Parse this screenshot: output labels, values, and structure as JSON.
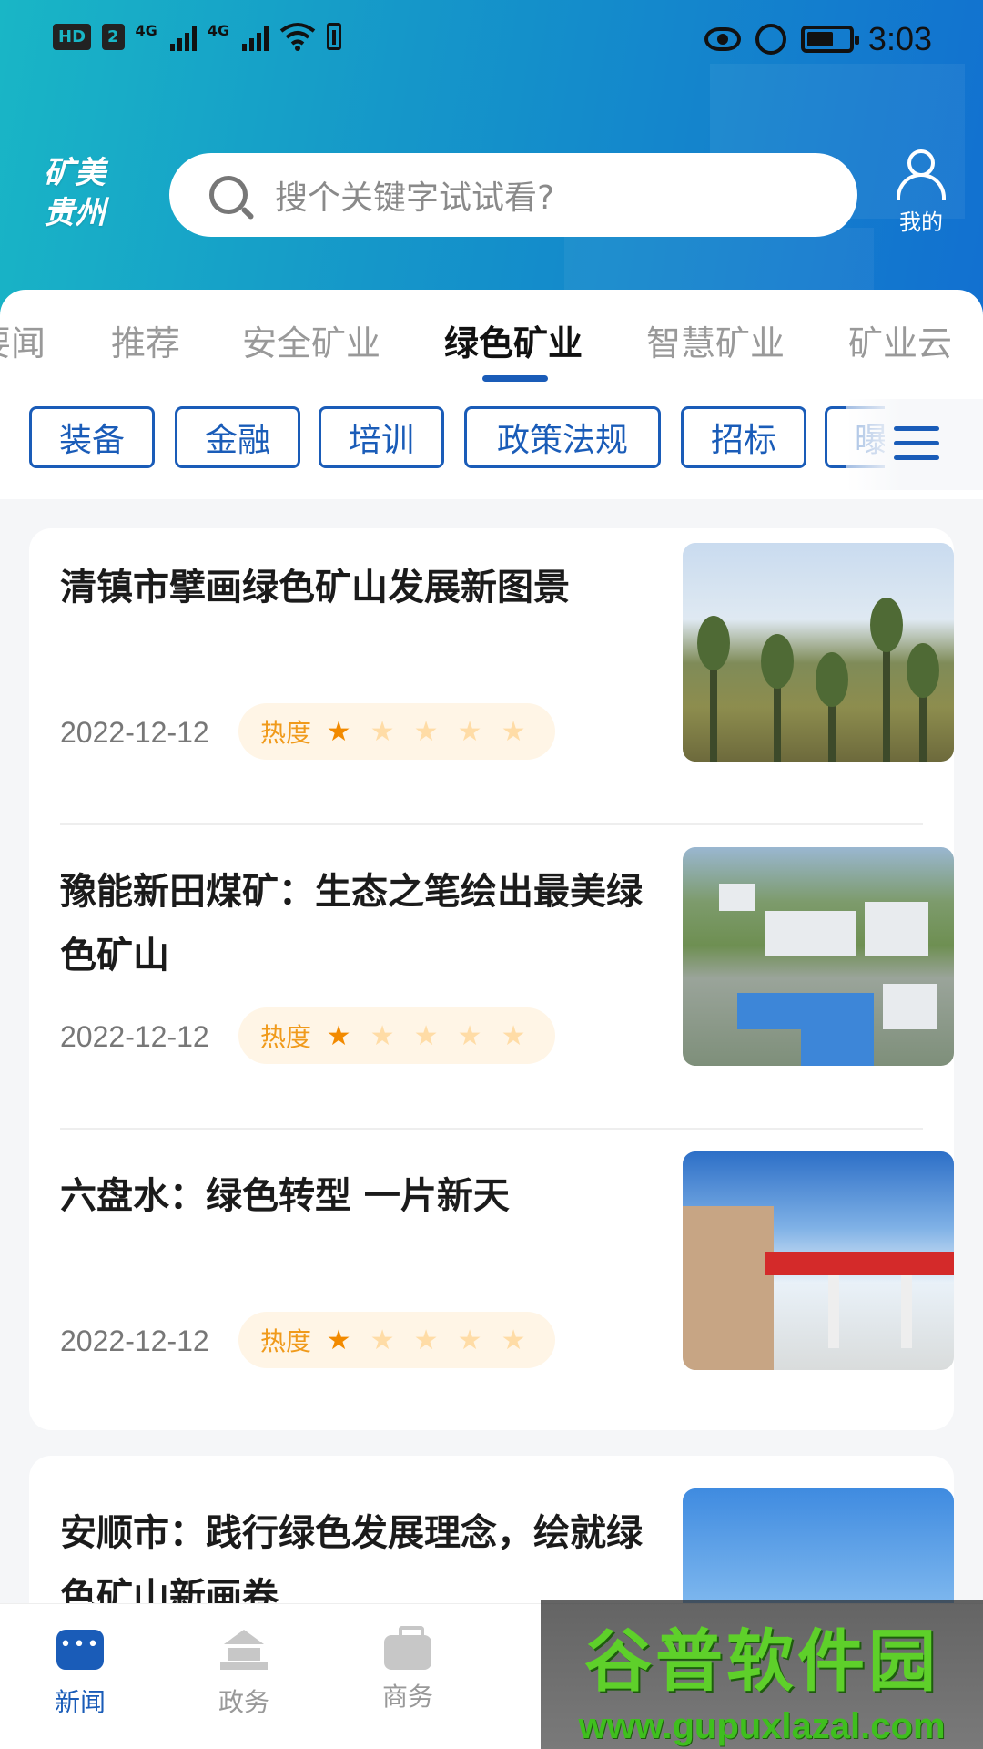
{
  "status_bar": {
    "left_badges": [
      "HD",
      "2"
    ],
    "signal_labels": [
      "4G",
      "4G"
    ],
    "time": "3:03"
  },
  "header": {
    "logo_line1": "矿美",
    "logo_line2": "贵州",
    "search_placeholder": "搜个关键字试试看?",
    "profile_label": "我的"
  },
  "tabs": [
    {
      "label": "要闻",
      "active": false
    },
    {
      "label": "推荐",
      "active": false
    },
    {
      "label": "安全矿业",
      "active": false
    },
    {
      "label": "绿色矿业",
      "active": true
    },
    {
      "label": "智慧矿业",
      "active": false
    },
    {
      "label": "矿业云",
      "active": false
    }
  ],
  "chips": [
    "装备",
    "金融",
    "培训",
    "政策法规",
    "招标",
    "曝"
  ],
  "articles": [
    {
      "title": "清镇市擘画绿色矿山发展新图景",
      "date": "2022-12-12",
      "heat_label": "热度",
      "heat_stars": 1,
      "max_stars": 5,
      "thumb": "pine-trees"
    },
    {
      "title": "豫能新田煤矿：生态之笔绘出最美绿色矿山",
      "date": "2022-12-12",
      "heat_label": "热度",
      "heat_stars": 1,
      "max_stars": 5,
      "thumb": "mine-facility"
    },
    {
      "title": "六盘水：绿色转型 一片新天",
      "date": "2022-12-12",
      "heat_label": "热度",
      "heat_stars": 1,
      "max_stars": 5,
      "thumb": "gas-station"
    },
    {
      "title": "安顺市：践行绿色发展理念，绘就绿色矿山新画卷",
      "thumb": "sky-hills"
    }
  ],
  "bottom_nav": [
    {
      "label": "新闻",
      "icon": "chat-icon",
      "active": true
    },
    {
      "label": "政务",
      "icon": "government-icon",
      "active": false
    },
    {
      "label": "商务",
      "icon": "briefcase-icon",
      "active": false
    }
  ],
  "watermark": {
    "title": "谷普软件园",
    "url": "www.gupuxlazal.com"
  },
  "colors": {
    "primary": "#1a5cb8",
    "header_start": "#19b6c6",
    "header_end": "#1270d0",
    "heat": "#f28a00"
  }
}
